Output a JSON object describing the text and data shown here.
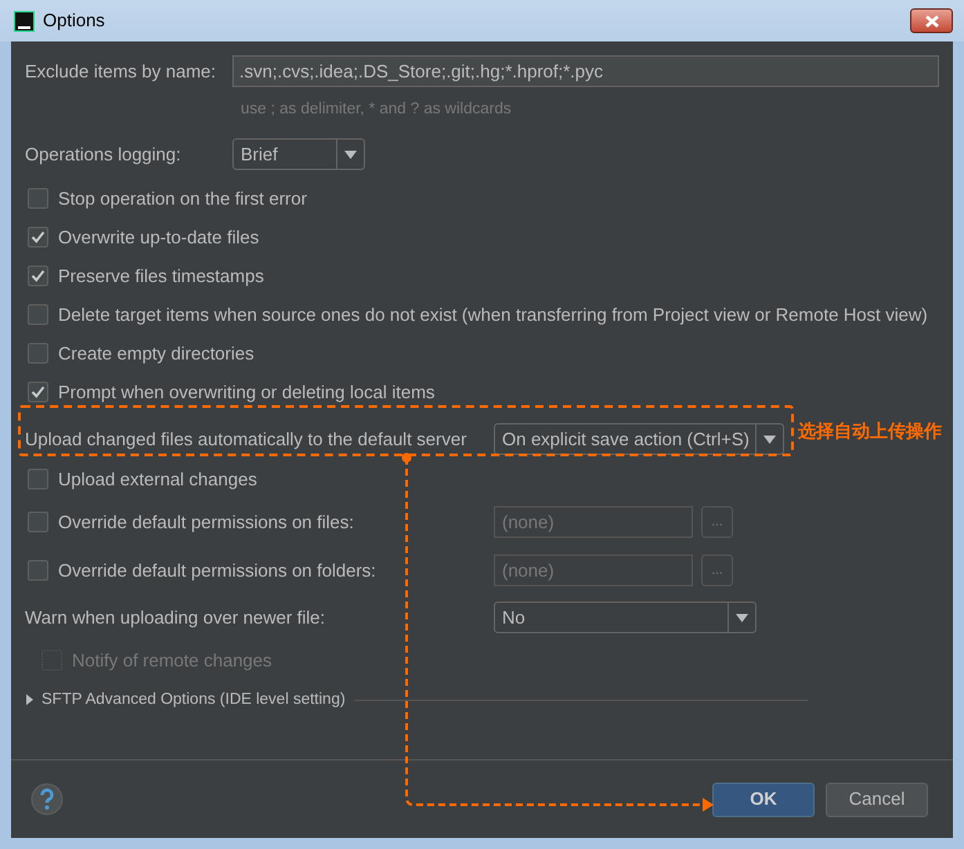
{
  "window": {
    "title": "Options"
  },
  "exclude": {
    "label": "Exclude items by name:",
    "value": ".svn;.cvs;.idea;.DS_Store;.git;.hg;*.hprof;*.pyc",
    "hint": "use ; as delimiter, * and ? as wildcards"
  },
  "logging": {
    "label": "Operations logging:",
    "value": "Brief"
  },
  "items": [
    {
      "kind": "checkbox",
      "label": "Stop operation on the first error",
      "checked": false,
      "disabled": false
    },
    {
      "kind": "checkbox",
      "label": "Overwrite up-to-date files",
      "checked": true,
      "disabled": false
    },
    {
      "kind": "checkbox",
      "label": "Preserve files timestamps",
      "checked": true,
      "disabled": false
    },
    {
      "kind": "checkbox",
      "label": "Delete target items when source ones do not exist (when transferring from Project view or Remote Host view)",
      "checked": false,
      "disabled": false
    },
    {
      "kind": "checkbox",
      "label": "Create empty directories",
      "checked": false,
      "disabled": false
    },
    {
      "kind": "checkbox",
      "label": "Prompt when overwriting or deleting local items",
      "checked": true,
      "disabled": false
    },
    {
      "kind": "dropdown",
      "label": "Upload changed files automatically to the default server",
      "value": "On explicit save action (Ctrl+S)",
      "highlighted": true
    },
    {
      "kind": "checkbox",
      "label": "Upload external changes",
      "checked": false,
      "disabled": false
    },
    {
      "kind": "checkbox_field",
      "label": "Override default permissions on files:",
      "checked": false,
      "placeholder": "(none)",
      "button": "..."
    },
    {
      "kind": "checkbox_field",
      "label": "Override default permissions on folders:",
      "checked": false,
      "placeholder": "(none)",
      "button": "..."
    },
    {
      "kind": "dropdown",
      "label": "Warn when uploading over newer file:",
      "value": "No",
      "highlighted": false
    },
    {
      "kind": "checkbox",
      "label": "Notify of remote changes",
      "checked": false,
      "disabled": true,
      "indented": true
    },
    {
      "kind": "section",
      "label": "SFTP Advanced Options (IDE level setting)",
      "expanded": false
    }
  ],
  "annotation": {
    "text": "选择自动上传操作"
  },
  "buttons": [
    {
      "label": "OK",
      "default": true
    },
    {
      "label": "Cancel",
      "default": false
    }
  ]
}
